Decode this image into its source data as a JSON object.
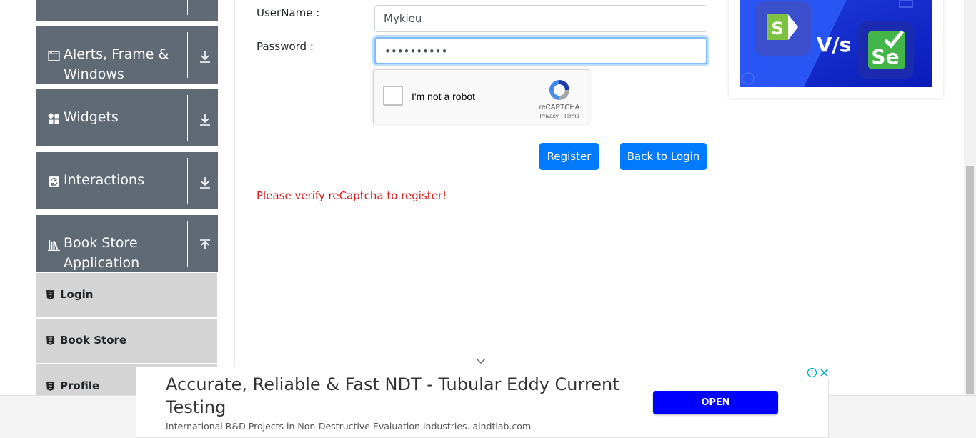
{
  "sidebar": {
    "groups": [
      {
        "title": "",
        "icon": "blank"
      },
      {
        "title_line1": "Alerts, Frame &",
        "title_line2": "Windows",
        "icon": "window-icon"
      },
      {
        "title": "Widgets",
        "icon": "widgets-icon"
      },
      {
        "title": "Interactions",
        "icon": "interactions-icon"
      },
      {
        "title_line1": "Book Store",
        "title_line2": "Application",
        "icon": "books-icon"
      }
    ],
    "items": [
      {
        "label": "Login",
        "icon": "html5-icon"
      },
      {
        "label": "Book Store",
        "icon": "html5-icon"
      },
      {
        "label": "Profile",
        "icon": "html5-icon"
      }
    ]
  },
  "form": {
    "username_label": "UserName :",
    "username_value": "Mykieu",
    "password_label": "Password :",
    "password_value": "••••••••••",
    "captcha_text": "I'm not a robot",
    "captcha_brand": "reCAPTCHA",
    "captcha_terms": "Privacy - Terms",
    "register_label": "Register",
    "back_label": "Back to Login",
    "error_text": "Please verify reCaptcha to register!"
  },
  "ad_top": {
    "letter_left": "S",
    "vs_text": "V/s",
    "letter_right": "Se"
  },
  "ad_bottom": {
    "headline": "Accurate, Reliable & Fast NDT - Tubular Eddy Current Testing",
    "sub": "International R&D Projects in Non-Destructive Evaluation Industries. aindtlab.com",
    "open_label": "OPEN"
  },
  "colors": {
    "sidebar_group": "#5f6a74",
    "sidebar_item": "#d4d4d4",
    "primary": "#007bff",
    "error": "#dc1c1c",
    "ad_open": "#0000ff"
  }
}
